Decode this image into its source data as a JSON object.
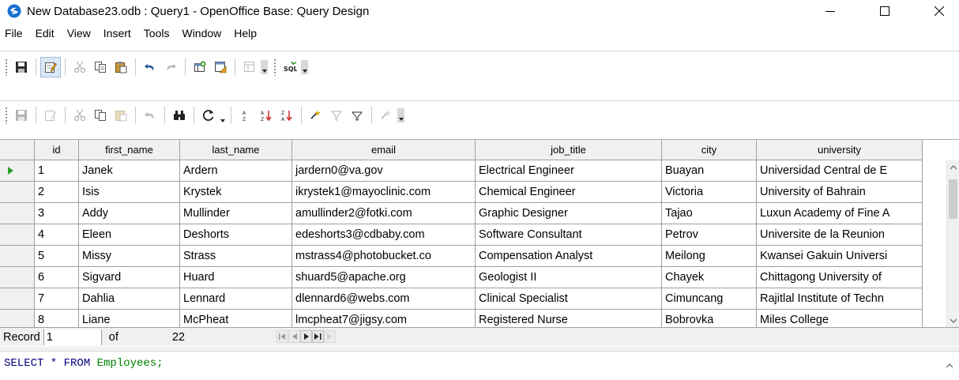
{
  "window": {
    "title": "New Database23.odb : Query1 - OpenOffice Base: Query Design",
    "icon": "openoffice-logo-icon"
  },
  "menu": [
    "File",
    "Edit",
    "View",
    "Insert",
    "Tools",
    "Window",
    "Help"
  ],
  "toolbar1": {
    "sql_label": "SQL"
  },
  "grid": {
    "columns": [
      {
        "label": "id",
        "width": 56
      },
      {
        "label": "first_name",
        "width": 128
      },
      {
        "label": "last_name",
        "width": 142
      },
      {
        "label": "email",
        "width": 232
      },
      {
        "label": "job_title",
        "width": 236
      },
      {
        "label": "city",
        "width": 120
      },
      {
        "label": "university",
        "width": 210
      }
    ],
    "rows": [
      [
        "1",
        "Janek",
        "Ardern",
        "jardern0@va.gov",
        "Electrical Engineer",
        "Buayan",
        "Universidad Central de E"
      ],
      [
        "2",
        "Isis",
        "Krystek",
        "ikrystek1@mayoclinic.com",
        "Chemical Engineer",
        "Victoria",
        "University of Bahrain"
      ],
      [
        "3",
        "Addy",
        "Mullinder",
        "amullinder2@fotki.com",
        "Graphic Designer",
        "Tajao",
        "Luxun Academy of Fine A"
      ],
      [
        "4",
        "Eleen",
        "Deshorts",
        "edeshorts3@cdbaby.com",
        "Software Consultant",
        "Petrov",
        "Universite de la Reunion"
      ],
      [
        "5",
        "Missy",
        "Strass",
        "mstrass4@photobucket.co",
        "Compensation Analyst",
        "Meilong",
        "Kwansei Gakuin Universi"
      ],
      [
        "6",
        "Sigvard",
        "Huard",
        "shuard5@apache.org",
        "Geologist II",
        "Chayek",
        "Chittagong University of"
      ],
      [
        "7",
        "Dahlia",
        "Lennard",
        "dlennard6@webs.com",
        "Clinical Specialist",
        "Cimuncang",
        "Rajitlal Institute of Techn"
      ],
      [
        "8",
        "Liane",
        "McPheat",
        "lmcpheat7@jigsy.com",
        "Registered Nurse",
        "Bobrovka",
        "Miles College"
      ]
    ],
    "current_row": 0
  },
  "record_bar": {
    "label": "Record",
    "current": "1",
    "of_label": "of",
    "total": "22"
  },
  "sql": {
    "select": "SELECT * FROM",
    "table": "Employees;"
  },
  "colors": {
    "accent": "#2aa02a",
    "sql_keyword": "#000080",
    "sql_identifier": "#008000"
  }
}
